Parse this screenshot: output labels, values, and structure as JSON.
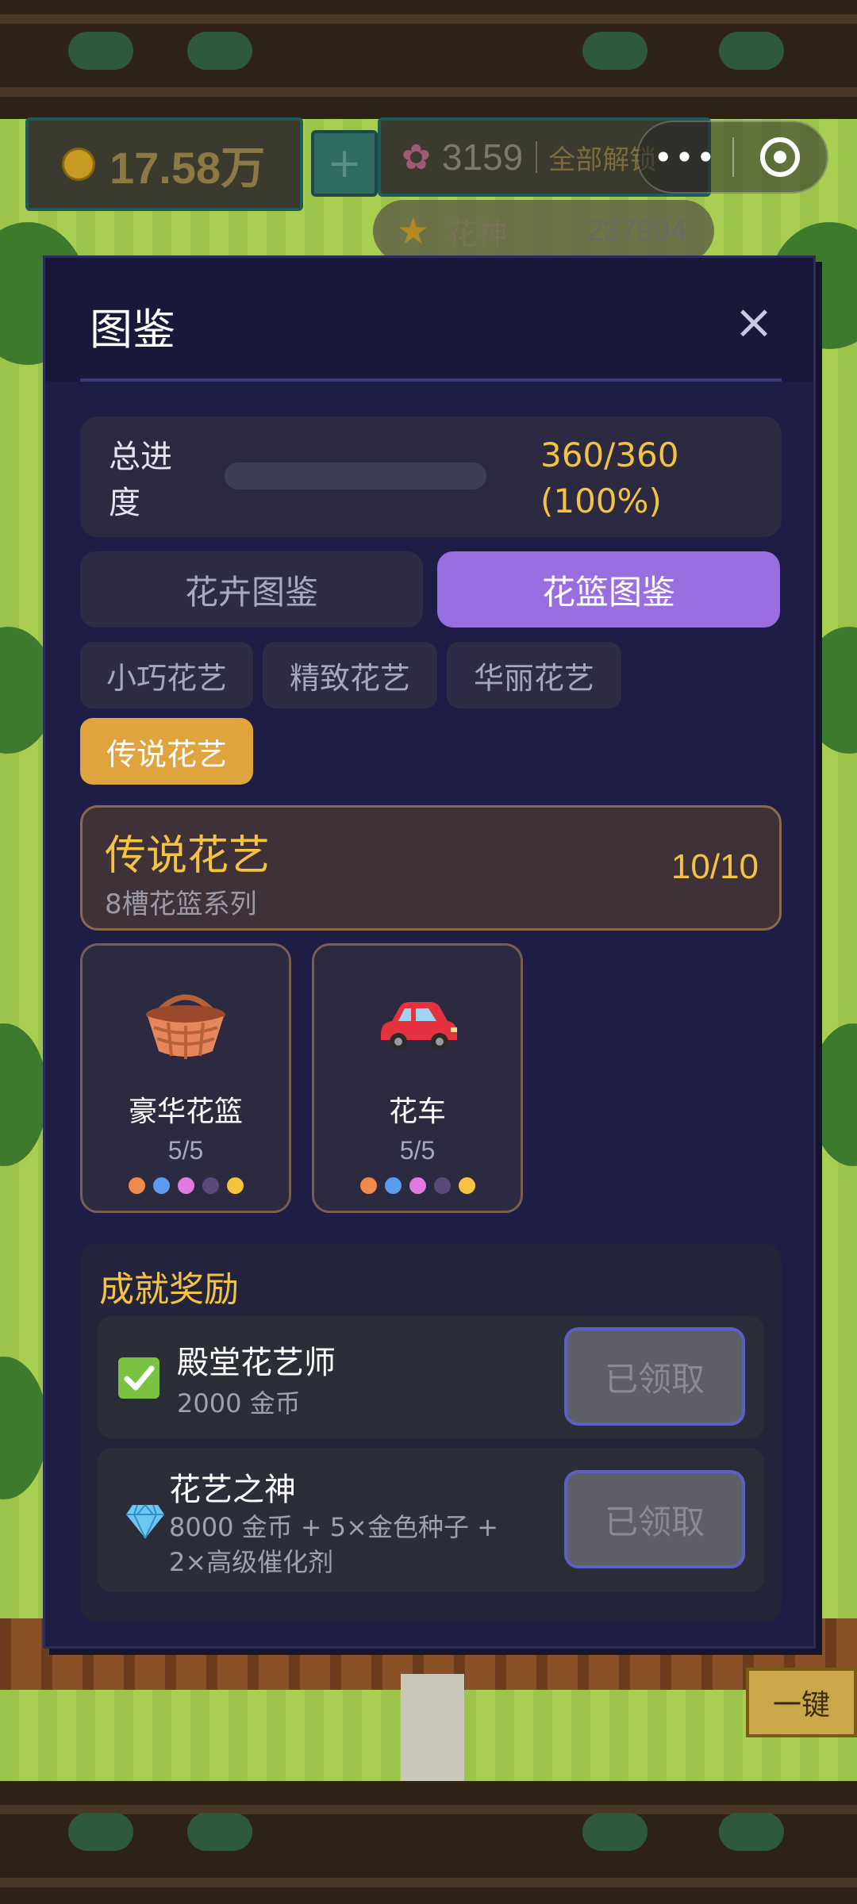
{
  "hud": {
    "coins": "17.58万",
    "plus": "+",
    "flowers": "3159",
    "unlock_all": "全部解锁",
    "capsule_more": "•••",
    "god_title": "花神",
    "god_score": "237994"
  },
  "side": {
    "one_click": "一键"
  },
  "modal": {
    "title": "图鉴",
    "close": "×",
    "progress": {
      "label": "总进度",
      "value": "360/360 (100%)",
      "fraction": 1.0
    },
    "tabs": [
      {
        "label": "花卉图鉴",
        "active": false
      },
      {
        "label": "花篮图鉴",
        "active": true
      }
    ],
    "categories": [
      {
        "label": "小巧花艺",
        "selected": false
      },
      {
        "label": "精致花艺",
        "selected": false
      },
      {
        "label": "华丽花艺",
        "selected": false
      },
      {
        "label": "传说花艺",
        "selected": true
      }
    ],
    "series": {
      "name": "传说花艺",
      "subtitle": "8槽花篮系列",
      "count": "10/10"
    },
    "items": [
      {
        "name": "豪华花篮",
        "count": "5/5",
        "icon": "basket-icon"
      },
      {
        "name": "花车",
        "count": "5/5",
        "icon": "car-icon"
      }
    ],
    "dot_colors": [
      "#f08a4b",
      "#5b9cf0",
      "#e07ae0",
      "#5a4a7a",
      "#f5c242"
    ],
    "rewards": {
      "title": "成就奖励",
      "items": [
        {
          "name": "殿堂花艺师",
          "desc": "2000 金币",
          "button": "已领取",
          "icon": "check-icon"
        },
        {
          "name": "花艺之神",
          "desc": "8000 金币 + 5×金色种子 + 2×高级催化剂",
          "button": "已领取",
          "icon": "diamond-icon"
        }
      ]
    }
  },
  "colors": {
    "accent_purple": "#9a6ee0",
    "accent_gold": "#f5c242",
    "chip_selected": "#e0a43e",
    "modal_bg": "#1e1d45"
  }
}
